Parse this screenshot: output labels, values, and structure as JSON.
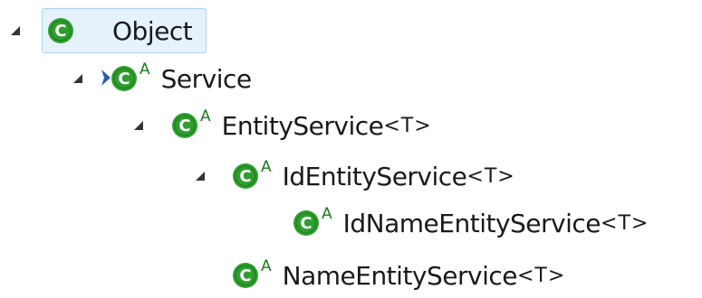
{
  "tree": {
    "nodes": [
      {
        "label": "Object",
        "generic": "",
        "abstract": false,
        "expanded": true
      },
      {
        "label": "Service",
        "generic": "",
        "abstract": true,
        "expanded": true
      },
      {
        "label": "EntityService",
        "generic": "<T>",
        "abstract": true,
        "expanded": true
      },
      {
        "label": "IdEntityService",
        "generic": "<T>",
        "abstract": true,
        "expanded": true
      },
      {
        "label": "IdNameEntityService",
        "generic": "<T>",
        "abstract": true,
        "expanded": false
      },
      {
        "label": "NameEntityService",
        "generic": "<T>",
        "abstract": true,
        "expanded": false
      }
    ],
    "abstract_mark": "A",
    "selected_index": 0
  },
  "colors": {
    "class_icon": "#2e9e2e",
    "selection_bg": "#e5f2fc",
    "selection_border": "#a9d4f5",
    "overlay_arrow": "#2b5ea8"
  },
  "icons": {
    "class": "class-icon",
    "expand": "expanded-triangle-icon",
    "overlay": "override-arrow-icon"
  }
}
